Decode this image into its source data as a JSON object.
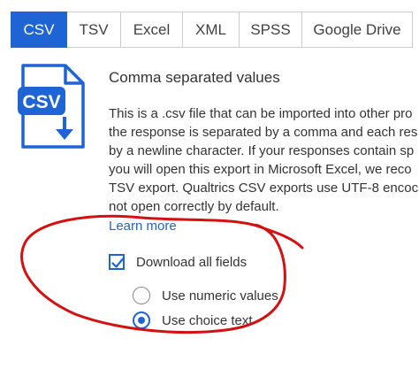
{
  "tabs": [
    {
      "label": "CSV",
      "active": true
    },
    {
      "label": "TSV",
      "active": false
    },
    {
      "label": "Excel",
      "active": false
    },
    {
      "label": "XML",
      "active": false
    },
    {
      "label": "SPSS",
      "active": false
    },
    {
      "label": "Google Drive",
      "active": false
    }
  ],
  "file_icon": {
    "label": "CSV",
    "icon": "csv-file-download-icon",
    "color": "#1f64d4"
  },
  "section_title": "Comma separated values",
  "description_lines": [
    "This is a .csv file that can be imported into other pro",
    "the response is separated by a comma and each res",
    "by a newline character. If your responses contain sp",
    "you will open this export in Microsoft Excel, we reco",
    "TSV export. Qualtrics CSV exports use UTF-8 encoc",
    "not open correctly by default."
  ],
  "learn_more": "Learn more",
  "download_all_fields": {
    "label": "Download all fields",
    "checked": true
  },
  "value_options": [
    {
      "label": "Use numeric values",
      "selected": false
    },
    {
      "label": "Use choice text",
      "selected": true
    }
  ],
  "colors": {
    "accent": "#1f64d4",
    "annotation": "#d41010"
  }
}
